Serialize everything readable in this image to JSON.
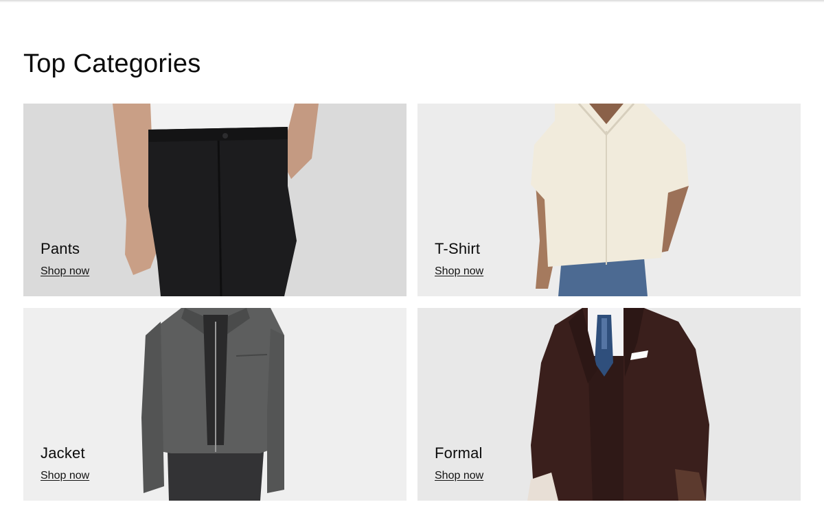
{
  "section": {
    "title": "Top Categories"
  },
  "categories": [
    {
      "label": "Pants",
      "link": "Shop now"
    },
    {
      "label": "T-Shirt",
      "link": "Shop now"
    },
    {
      "label": "Jacket",
      "link": "Shop now"
    },
    {
      "label": "Formal",
      "link": "Shop now"
    }
  ]
}
